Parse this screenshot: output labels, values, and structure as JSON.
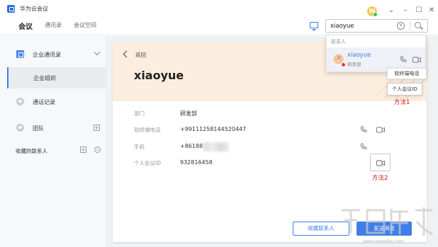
{
  "window": {
    "title": "华为云会议",
    "avatar_letter": "W"
  },
  "nav": {
    "tabs": [
      "会议",
      "通讯录",
      "会议空间"
    ],
    "search_value": "xiaoyue"
  },
  "sidebar": {
    "items": [
      {
        "label": "企业通讯录",
        "icon": "address-book-icon"
      },
      {
        "label": "企业组织"
      },
      {
        "label": "通话记录",
        "icon": "call-record-icon"
      },
      {
        "label": "团队",
        "icon": "team-icon"
      },
      {
        "label": "收藏的联系人"
      }
    ]
  },
  "card": {
    "back_label": "返回",
    "name": "xiaoyue",
    "fields": [
      {
        "label": "部门",
        "value": "研发部"
      },
      {
        "label": "软终端电话",
        "value": "+99111258144520447"
      },
      {
        "label": "手机",
        "value": "+86188"
      },
      {
        "label": "个人会议ID",
        "value": "932816458"
      }
    ],
    "buttons": {
      "favorite": "收藏联系人",
      "message": "发送消息"
    }
  },
  "dropdown": {
    "header": "联系人",
    "result_name": "xiaoyue",
    "result_dept": "研发部"
  },
  "tooltips": {
    "softphone": "软终端电话",
    "meeting_id": "个人会议ID"
  },
  "annotations": {
    "method1": "方法1",
    "method2": "方法2"
  },
  "colors": {
    "accent": "#3f7ee8",
    "annotation": "#c81818",
    "header_bg": "#fbeede"
  }
}
